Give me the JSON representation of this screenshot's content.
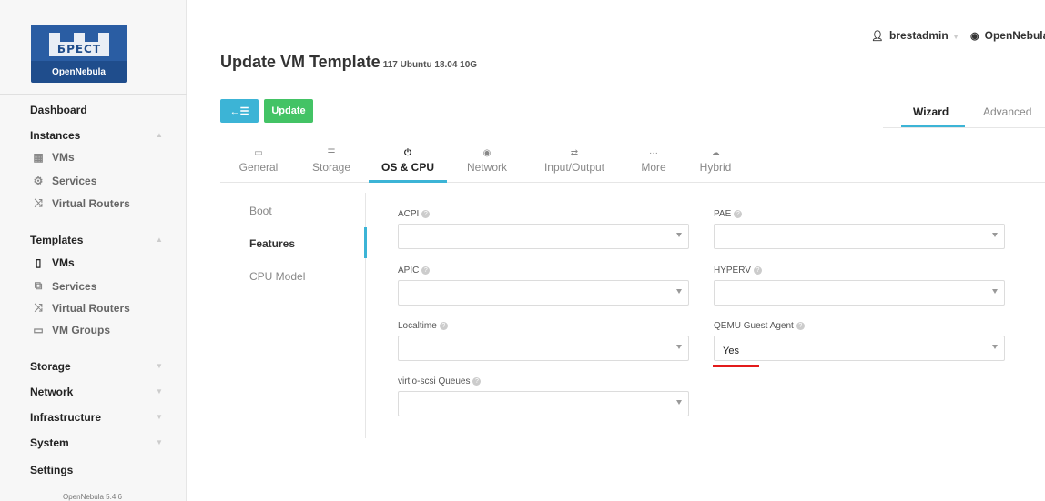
{
  "sidebar": {
    "logo": {
      "brand": "БРЕСТ",
      "product": "OpenNebula"
    },
    "sections": {
      "dashboard": "Dashboard",
      "instances": "Instances",
      "instances_items": [
        "VMs",
        "Services",
        "Virtual Routers"
      ],
      "templates": "Templates",
      "templates_items": [
        "VMs",
        "Services",
        "Virtual Routers",
        "VM Groups"
      ],
      "storage": "Storage",
      "network": "Network",
      "infrastructure": "Infrastructure",
      "system": "System",
      "settings": "Settings"
    },
    "version": "OpenNebula 5.4.6"
  },
  "header": {
    "user": "brestadmin",
    "zone": "OpenNebula",
    "title": "Update VM Template",
    "subtitle": "117 Ubuntu 18.04 10G"
  },
  "toolbar": {
    "back_label": "←☰",
    "update_label": "Update",
    "wizard_label": "Wizard",
    "advanced_label": "Advanced"
  },
  "tabs": [
    "General",
    "Storage",
    "OS & CPU",
    "Network",
    "Input/Output",
    "More",
    "Hybrid"
  ],
  "subnav": [
    "Boot",
    "Features",
    "CPU Model"
  ],
  "fields": {
    "acpi": {
      "label": "ACPI",
      "value": ""
    },
    "pae": {
      "label": "PAE",
      "value": ""
    },
    "apic": {
      "label": "APIC",
      "value": ""
    },
    "hyperv": {
      "label": "HYPERV",
      "value": ""
    },
    "localtime": {
      "label": "Localtime",
      "value": ""
    },
    "qemu_agent": {
      "label": "QEMU Guest Agent",
      "value": "Yes"
    },
    "virtio_scsi": {
      "label": "virtio-scsi Queues",
      "value": ""
    }
  },
  "colors": {
    "accent": "#3cb4d6",
    "update": "#43c365",
    "annotation": "#e31b1b"
  }
}
